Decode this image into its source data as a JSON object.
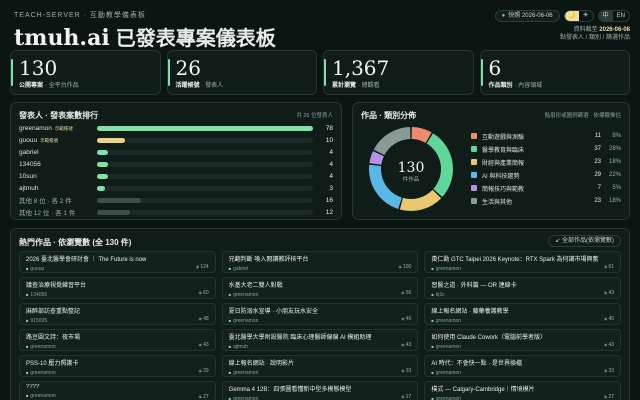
{
  "header": {
    "kicker": "TEACH-SERVER · 互動教學儀表板",
    "brand": "tmuh.ai",
    "title": "已發表專案儀表板",
    "live_date": "快照 2026-06-06",
    "theme_dark": "🌙",
    "theme_light": "☀",
    "lang_zh": "中",
    "lang_en": "EN",
    "meta_label": "資料截至",
    "meta_date": "2026-06-08",
    "meta_line2": "點發表人 / 類別 / 篩選作品"
  },
  "stats": [
    {
      "num": "130",
      "label": "公開專案",
      "sub": "· 全平台作品"
    },
    {
      "num": "26",
      "label": "活躍帳號",
      "sub": "· 發表人"
    },
    {
      "num": "1,367",
      "label": "累計瀏覽",
      "sub": "· 總觀看"
    },
    {
      "num": "6",
      "label": "作品類別",
      "sub": "· 內容領域"
    }
  ],
  "authors": {
    "title": "發表人 · 發表案數排行",
    "note": "共 26 位發表人",
    "max": 78,
    "rows": [
      {
        "name": "greenamon",
        "tag": "示範帳號",
        "count": 78,
        "color": "#7fe0a8"
      },
      {
        "name": "guouu",
        "tag": "示範帳號",
        "count": 10,
        "color": "#e9d48a"
      },
      {
        "name": "gabriel",
        "tag": "",
        "count": 4,
        "color": "#7fe0a8"
      },
      {
        "name": "134056",
        "tag": "",
        "count": 4,
        "color": "#7fe0a8"
      },
      {
        "name": "10sun",
        "tag": "",
        "count": 4,
        "color": "#7fe0a8"
      },
      {
        "name": "ajtmuh",
        "tag": "",
        "count": 3,
        "color": "#7fe0a8"
      },
      {
        "name": "其他 8 位 · 各 2 件",
        "tag": "",
        "count": 16,
        "color": "#3e4f48",
        "muted": true
      },
      {
        "name": "其他 12 位 · 各 1 件",
        "tag": "",
        "count": 12,
        "color": "#3e4f48",
        "muted": true
      }
    ]
  },
  "categories": {
    "title": "作品 · 類別分佈",
    "note": "點扇形或圖例篩選 · 依標籤推估",
    "center_num": "130",
    "center_label": "件作品",
    "items": [
      {
        "name": "互動遊戲與測驗",
        "count": 11,
        "pct": "8%",
        "color": "#f08a6c"
      },
      {
        "name": "醫學教育與臨床",
        "count": 37,
        "pct": "28%",
        "color": "#5fd69a"
      },
      {
        "name": "財經與產業簡報",
        "count": 23,
        "pct": "18%",
        "color": "#e9c870"
      },
      {
        "name": "AI 與科技趨勢",
        "count": 29,
        "pct": "22%",
        "color": "#5ab8e8"
      },
      {
        "name": "簡報技巧與範教",
        "count": 7,
        "pct": "5%",
        "color": "#b692e6"
      },
      {
        "name": "生活與其他",
        "count": 23,
        "pct": "18%",
        "color": "#8a9a94"
      }
    ]
  },
  "works": {
    "title": "熱門作品 · 依瀏覽數",
    "count_label": "(全 130 件)",
    "view_all": "↙ 全部作品(依瀏覽數)",
    "cards": [
      {
        "title": "2026 臺北醫學會研討會 ｜ The Future is now",
        "author": "guouu",
        "views": "124"
      },
      {
        "title": "兄翻判斷 喚入閱讀教評核平台",
        "author": "gabriel",
        "views": "100"
      },
      {
        "title": "黃仁勳 GTC Taipei 2026 Keynote：RTX Spark 為何讓市場興奮",
        "author": "greenamon",
        "views": "61"
      },
      {
        "title": "議查治療視覺練習平台",
        "author": "134056",
        "views": "60"
      },
      {
        "title": "水基大老二雙人對戰",
        "author": "greenamon",
        "views": "56",
        "views_pre": "₱"
      },
      {
        "title": "習醫之道 · 外科篇 — OR 連線卡",
        "author": "kj3c",
        "views": "43"
      },
      {
        "title": "麻醉部訪查重點整記",
        "author": "915035",
        "views": "48"
      },
      {
        "title": "夏日防溺水宣導 · 小朋友玩水安全",
        "author": "greenamon",
        "views": "46"
      },
      {
        "title": "線上報名網站 · 藤藥養護教學",
        "author": "greenamon",
        "views": "45"
      },
      {
        "title": "路豆圓文詩：夜市場",
        "author": "greenamon",
        "views": "43"
      },
      {
        "title": "臺北醫學大學附設醫院 臨床心理醫師偏偏 AI 模組助理",
        "author": "ajtmuh",
        "views": "43"
      },
      {
        "title": "如何使用 Claude Cowork（電腦前學者版）",
        "author": "greenamon",
        "views": "43"
      },
      {
        "title": "PSS-10 壓力照護卡",
        "author": "greenamon",
        "views": "39"
      },
      {
        "title": "線上報名網站 · 說明影片",
        "author": "greenamon",
        "views": "33"
      },
      {
        "title": "AI 時代：不會快一點 · 是世界換檔",
        "author": "greenamon",
        "views": "33"
      },
      {
        "title": "????",
        "author": "greenamon",
        "views": "27"
      },
      {
        "title": "Gemma 4 12B：四張圖看懂新中型多模態模型",
        "author": "greenamon",
        "views": "27"
      },
      {
        "title": "樸式 — Calgary-Cambridge｜情境模片",
        "author": "greenamon",
        "views": "27"
      }
    ]
  }
}
